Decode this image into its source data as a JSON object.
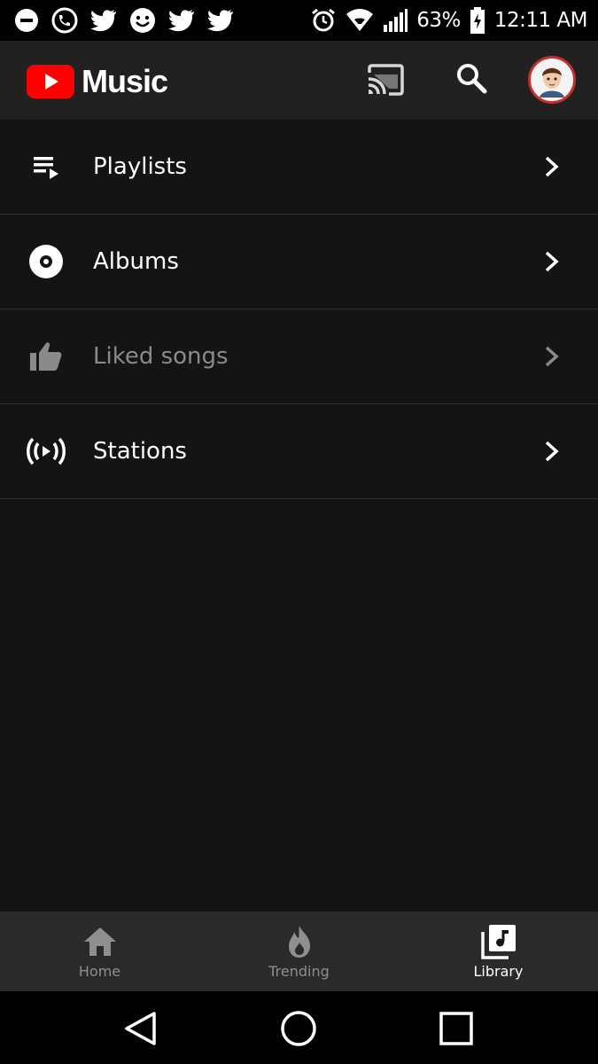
{
  "status_bar": {
    "left_icons": [
      "minus-circle-icon",
      "wifi-call-icon",
      "twitter-icon",
      "smiley-icon",
      "twitter-icon",
      "twitter-icon"
    ],
    "battery_percent": "63%",
    "time": "12:11 AM"
  },
  "header": {
    "app_name": "Music"
  },
  "library": {
    "items": [
      {
        "label": "Playlists",
        "icon": "playlist-icon"
      },
      {
        "label": "Albums",
        "icon": "album-icon"
      },
      {
        "label": "Liked songs",
        "icon": "thumbs-up-icon",
        "dimmed": true
      },
      {
        "label": "Stations",
        "icon": "radio-station-icon"
      }
    ]
  },
  "bottom_nav": {
    "items": [
      {
        "label": "Home",
        "icon": "home-icon"
      },
      {
        "label": "Trending",
        "icon": "flame-icon"
      },
      {
        "label": "Library",
        "icon": "library-icon",
        "active": true
      }
    ]
  },
  "colors": {
    "brand_red": "#ff0000",
    "background": "#141414",
    "header": "#212121"
  }
}
